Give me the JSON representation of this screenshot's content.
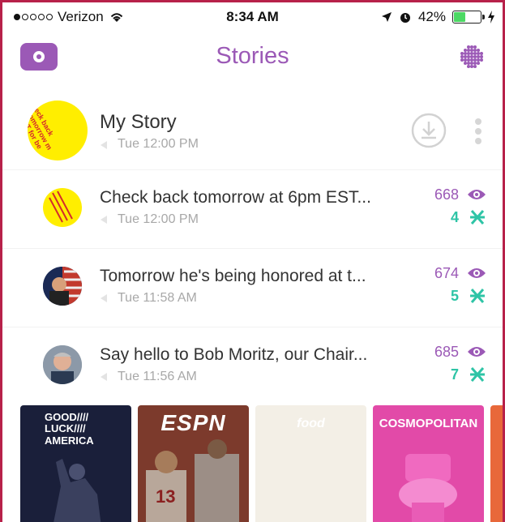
{
  "status_bar": {
    "carrier": "Verizon",
    "time": "8:34 AM",
    "battery": "42%",
    "battery_level": 0.42
  },
  "header": {
    "title": "Stories",
    "accent_color": "#9b59b6"
  },
  "my_story": {
    "name": "My Story",
    "time": "Tue 12:00 PM",
    "avatar_text": "eck back tomorrow m EST for be some access!"
  },
  "stories": [
    {
      "title": "Check back tomorrow at 6pm EST...",
      "time": "Tue 12:00 PM",
      "views": "668",
      "screenshots": "4",
      "thumb": "yellow-text"
    },
    {
      "title": "Tomorrow he's being honored at t...",
      "time": "Tue 11:58 AM",
      "views": "674",
      "screenshots": "5",
      "thumb": "flag"
    },
    {
      "title": "Say hello to Bob Moritz, our Chair...",
      "time": "Tue 11:56 AM",
      "views": "685",
      "screenshots": "7",
      "thumb": "portrait"
    }
  ],
  "discover": [
    {
      "label": "GOOD//// LUCK//// AMERICA"
    },
    {
      "label": "ESPN"
    },
    {
      "label": "food"
    },
    {
      "label": "COSMOPOLITAN"
    }
  ],
  "colors": {
    "views": "#9b59b6",
    "screenshots": "#2ec4a6"
  }
}
